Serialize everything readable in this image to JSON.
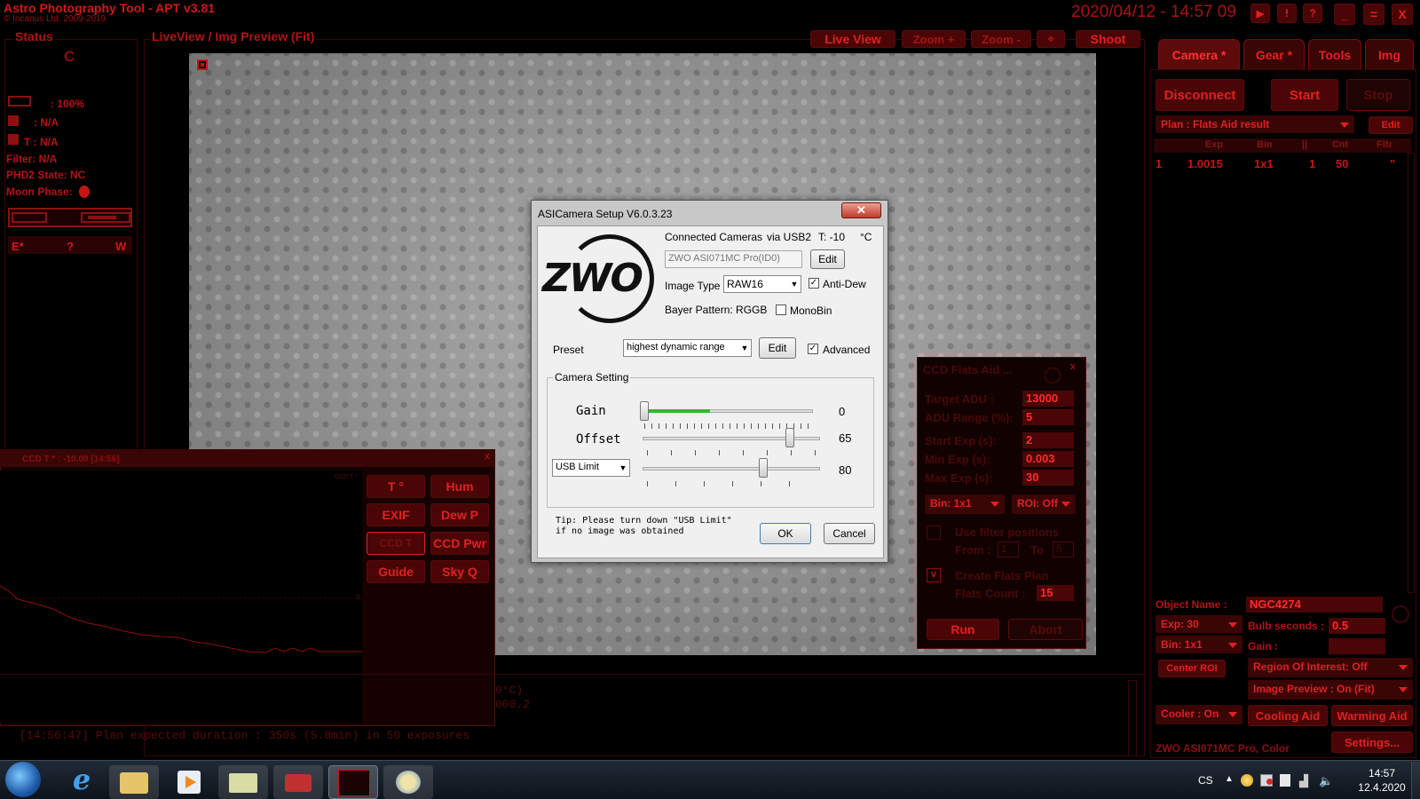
{
  "app": {
    "title": "Astro Photography Tool  -  APT v3.81",
    "copyright": "© Incanus Ltd. 2009-2019",
    "datetime": "2020/04/12 - 14:57 09",
    "header_btn_min": "_",
    "header_btn_max": "=",
    "header_btn_close": "X"
  },
  "status_panel": {
    "title": "Status",
    "connection_letter": "C",
    "battery": ": 100%",
    "power": ": N/A",
    "temp": "T : N/A",
    "filter": "Filter: N/A",
    "phd2": "PHD2 State: NC",
    "moon": "Moon Phase:",
    "e_label": "E*",
    "q_label": "?",
    "w_label": "W"
  },
  "liveview": {
    "title": "LiveView / Img Preview (Fit)",
    "live_view": "Live View",
    "zoom_in": "Zoom +",
    "zoom_out": "Zoom -",
    "shoot": "Shoot"
  },
  "right_tabs": [
    "Camera *",
    "Gear *",
    "Tools",
    "Img"
  ],
  "camera_tab": {
    "disconnect": "Disconnect",
    "start": "Start",
    "stop": "Stop",
    "plan": "Plan : Flats Aid result",
    "edit": "Edit",
    "plan_columns": [
      "",
      "Exp",
      "Bin",
      "||",
      "Cnt",
      "Fltr"
    ],
    "plan_rows": [
      [
        "1",
        "1.0015",
        "1x1",
        "1",
        "50",
        "\""
      ]
    ],
    "object_name_label": "Object Name :",
    "object_name": "NGC4274",
    "exp": "Exp: 30",
    "bulb_label": "Bulb seconds :",
    "bulb_value": "0.5",
    "bin": "Bin: 1x1",
    "gain_label": "Gain :",
    "center_roi": "Center ROI",
    "roi": "Region Of Interest: Off",
    "img_preview": "Image Preview : On (Fit)",
    "cooler": "Cooler : On",
    "cooling_aid": "Cooling Aid",
    "warming_aid": "Warming Aid",
    "camera_name": "ZWO ASI071MC Pro, Color",
    "settings": "Settings..."
  },
  "ccd_temp_panel": {
    "title": "CCD T * : -10.00 [14:56]",
    "chart_label": "CCD T *",
    "zero_label": "0",
    "buttons": [
      "T °",
      "Hum",
      "EXIF",
      "Dew P",
      "CCD T",
      "CCD Pwr",
      "Guide",
      "Sky Q"
    ]
  },
  "log": {
    "line1": "[14:56:47] Plan expected duration : 350s (5.8min) in 50 exposures",
    "frag1": "0°C)",
    "frag2": "000.2"
  },
  "flats_aid": {
    "title": "CCD Flats Aid ...",
    "target_adu_label": "Target ADU :",
    "target_adu": "13000",
    "adu_range_label": "ADU Range (%):",
    "adu_range": "5",
    "start_exp_label": "Start Exp (s):",
    "start_exp": "2",
    "min_exp_label": "Min Exp (s):",
    "min_exp": "0.003",
    "max_exp_label": "Max Exp (s):",
    "max_exp": "30",
    "bin": "Bin: 1x1",
    "roi": "ROI: Off",
    "use_filter": "Use filter positions",
    "from_label": "From :",
    "from_value": "1",
    "to_label": "To",
    "to_value": "5",
    "create_plan": "Create Flats Plan",
    "create_check": "v",
    "flats_count_label": "Flats Count :",
    "flats_count": "15",
    "run": "Run",
    "abort": "Abort"
  },
  "dialog": {
    "title": "ASICamera Setup V6.0.3.23",
    "connected_label": "Connected Cameras",
    "via": "via USB2",
    "temp": "T: -10",
    "temp_unit": "°C",
    "camera": "ZWO ASI071MC Pro(ID0)",
    "edit": "Edit",
    "image_type_label": "Image Type",
    "image_type": "RAW16",
    "anti_dew": "Anti-Dew",
    "bayer": "Bayer Pattern: RGGB",
    "monobin": "MonoBin",
    "preset_label": "Preset",
    "preset": "highest dynamic range",
    "preset_edit": "Edit",
    "advanced": "Advanced",
    "group_title": "Camera Setting",
    "gain_label": "Gain",
    "gain_value": "0",
    "offset_label": "Offset",
    "offset_value": "65",
    "usb_label": "USB Limit",
    "usb_value": "80",
    "tip1": "Tip: Please turn down \"USB Limit\"",
    "tip2": "if no image was obtained",
    "ok": "OK",
    "cancel": "Cancel",
    "logo": "ZWO",
    "gain_fraction": 0.0,
    "offset_fraction": 0.83,
    "usb_fraction": 0.67
  },
  "taskbar": {
    "lang": "CS",
    "time": "14:57",
    "date": "12.4.2020"
  }
}
